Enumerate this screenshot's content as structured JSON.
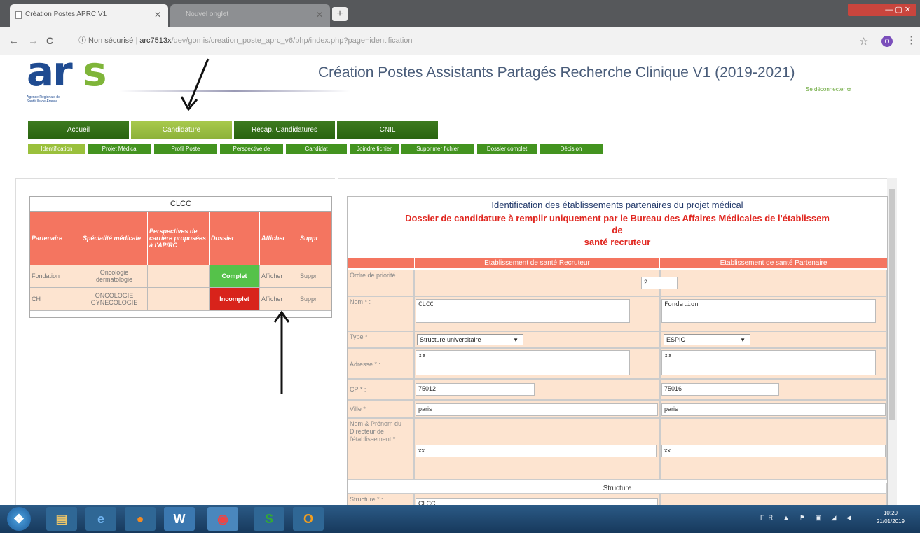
{
  "browser": {
    "tabs": [
      {
        "label": "Création Postes APRC V1",
        "active": true
      },
      {
        "label": "Nouvel onglet",
        "active": false
      }
    ],
    "new_tab": "+",
    "window_controls": "— ▢ ✕",
    "nav": {
      "back": "←",
      "forward": "→",
      "reload": "C"
    },
    "address": {
      "security": "ⓘ Non sécurisé",
      "host": "arc7513x",
      "path": "/dev/gomis/creation_poste_aprc_v6/php/index.php?page=identification"
    },
    "star": "☆",
    "profile": "O",
    "menu": "⋮"
  },
  "header": {
    "logo_text_ar": "ar",
    "logo_text_s": "s",
    "logo_subtext": "Agence Régionale de Santé Île-de-France",
    "title": "Création Postes Assistants Partagés Recherche Clinique V1 (2019-2021)",
    "logout": "Se déconnecter ⊗"
  },
  "main_menu": [
    "Accueil",
    "Candidature",
    "Recap. Candidatures",
    "CNIL"
  ],
  "sub_menu": [
    "Identification",
    "Projet Médical",
    "Profil Poste",
    "Perspective de",
    "Candidat",
    "Joindre fichier",
    "Supprimer fichier",
    "Dossier complet",
    "Décision"
  ],
  "left_table": {
    "title": "CLCC",
    "headers": [
      "Partenaire",
      "Spécialité médicale",
      "Perspectives de carrière proposées à l'AP/RC",
      "Dossier",
      "Afficher",
      "Suppr"
    ],
    "rows": [
      {
        "partenaire": "Fondation",
        "specialite": "Oncologie dermatologie",
        "perspectives": "",
        "dossier": "Complet",
        "afficher": "Afficher",
        "suppr": "Suppr"
      },
      {
        "partenaire": "CH",
        "specialite": "ONCOLOGIE GYNECOLOGIE",
        "perspectives": "",
        "dossier": "Incomplet",
        "afficher": "Afficher",
        "suppr": "Suppr"
      }
    ]
  },
  "form": {
    "title1": "Identification des établissements partenaires du projet médical",
    "title2_line1": "Dossier de candidature à remplir uniquement par le Bureau des Affaires Médicales de l'établissem",
    "title2_line2": "de",
    "title2_line3": "santé recruteur",
    "col_recruteur": "Etablissement de santé Recruteur",
    "col_partenaire": "Etablissement de santé Partenaire",
    "labels": {
      "ordre": "Ordre de priorité",
      "nom": "Nom * :",
      "type": "Type *",
      "adresse": "Adresse * :",
      "cp": "CP * :",
      "ville": "Ville *",
      "directeur": "Nom & Prénom du Directeur de l'établissement *"
    },
    "values": {
      "ordre": "2",
      "nom_recruteur": "CLCC",
      "nom_partenaire": "Fondation",
      "type_recruteur": "Structure universitaire",
      "type_partenaire": "ESPIC",
      "adresse_recruteur": "xx",
      "adresse_partenaire": "xx",
      "cp_recruteur": "75012",
      "cp_partenaire": "75016",
      "ville_recruteur": "paris",
      "ville_partenaire": "paris",
      "directeur_recruteur": "xx",
      "directeur_partenaire": "xx"
    },
    "structure_section": "Structure",
    "structure_label": "Structure * :",
    "structure_value": "CLCC"
  },
  "taskbar": {
    "apps": [
      "start-orb",
      "file-explorer",
      "internet-explorer",
      "firefox",
      "word",
      "chrome",
      "app-s",
      "outlook"
    ],
    "tray": "FR ▲ ⚑ ▣ ◢ ◀",
    "time": "10:20",
    "date": "21/01/2019"
  },
  "colors": {
    "menu_dark_green": "#2a6410",
    "menu_active": "#9ac03c",
    "table_header": "#f47560",
    "cell_bg": "#fde4d0",
    "complet": "#55c24a",
    "incomplet": "#d8231b",
    "title_red": "#e0261f"
  }
}
